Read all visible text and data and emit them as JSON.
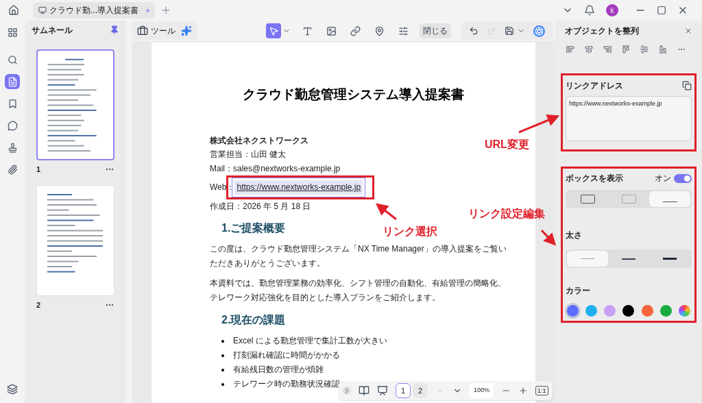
{
  "tab_bar": {
    "tabs": [
      {
        "label": "クラウド勤...導入提案書",
        "selected": true,
        "unsaved": true
      }
    ],
    "avatar": "k"
  },
  "left_rail": {
    "items": [
      {
        "kind": "grid",
        "selected": false
      },
      {
        "kind": "search",
        "selected": false
      },
      {
        "kind": "pages",
        "selected": true
      },
      {
        "kind": "bookmark",
        "selected": false
      },
      {
        "kind": "comment",
        "selected": false
      },
      {
        "kind": "stamp",
        "selected": false
      },
      {
        "kind": "attachment",
        "selected": false
      }
    ]
  },
  "thumbnails": {
    "title": "サムネール",
    "pages": [
      {
        "number": "1",
        "selected": true
      },
      {
        "number": "2",
        "selected": false
      }
    ]
  },
  "toolbar": {
    "tools_label": "ツール",
    "tools": [
      {
        "kind": "select",
        "selected": true
      },
      {
        "kind": "text",
        "selected": false
      },
      {
        "kind": "image",
        "selected": false
      },
      {
        "kind": "link",
        "selected": false
      },
      {
        "kind": "stamp",
        "selected": false
      },
      {
        "kind": "settings",
        "selected": false
      }
    ],
    "close_label": "閉じる",
    "redo_disabled": true
  },
  "document": {
    "title": "クラウド勤怠管理システム導入提案書",
    "company": "株式会社ネクストワークス",
    "contact": "営業担当：山田 健太",
    "mail": "Mail：sales@nextworks-example.jp",
    "web_prefix": "Web：",
    "link": {
      "text": "https://www.nextworks-example.jp",
      "selected": true
    },
    "date": "作成日：2026 年 5 月 18 日",
    "sections": [
      {
        "heading": "1.ご提案概要",
        "paragraphs": [
          "この度は、クラウド勤怠管理システム「NX Time Manager」の導入提案をご覧いただきありがとうございます。",
          "本資料では、勤怠管理業務の効率化、シフト管理の自動化、有給管理の簡略化、テレワーク対応強化を目的とした導入プランをご紹介します。"
        ]
      },
      {
        "heading": "2.現在の課題",
        "bullets": [
          "Excel による勤怠管理で集計工数が大きい",
          "打刻漏れ確認に時間がかかる",
          "有給残日数の管理が煩雑",
          "テレワーク時の勤務状況確認"
        ]
      }
    ]
  },
  "page_nav": {
    "pages": [
      {
        "label": "1",
        "selected": true
      },
      {
        "label": "2",
        "selected": false
      }
    ],
    "zoom": "100%",
    "fit_label": "1:1"
  },
  "properties": {
    "title": "オブジェクトを整列",
    "link_address": {
      "label": "リンクアドレス",
      "value": "https://www.nextworks-example.jp"
    },
    "show_box": {
      "label": "ボックスを表示",
      "state_label": "オン",
      "on": true
    },
    "box_styles": [
      {
        "kind": "solid",
        "selected": false
      },
      {
        "kind": "dashed",
        "selected": false
      },
      {
        "kind": "underline",
        "selected": true
      }
    ],
    "thickness": {
      "label": "太さ",
      "options": [
        {
          "kind": "thin",
          "selected": true
        },
        {
          "kind": "medium",
          "selected": false
        },
        {
          "kind": "thick",
          "selected": false
        }
      ]
    },
    "color": {
      "label": "カラー",
      "swatches": [
        {
          "kind": "solid",
          "color": "#5b6cff",
          "selected": true
        },
        {
          "kind": "solid",
          "color": "#1fb0f0",
          "selected": false
        },
        {
          "kind": "solid",
          "color": "#c9a0f5",
          "selected": false
        },
        {
          "kind": "solid",
          "color": "#000000",
          "selected": false
        },
        {
          "kind": "solid",
          "color": "#f5643c",
          "selected": false
        },
        {
          "kind": "solid",
          "color": "#1aab40",
          "selected": false
        },
        {
          "kind": "multicolor",
          "selected": false
        }
      ]
    }
  },
  "annotations": [
    {
      "label": "URL変更"
    },
    {
      "label": "リンク設定編集"
    },
    {
      "label": "リンク選択"
    }
  ]
}
